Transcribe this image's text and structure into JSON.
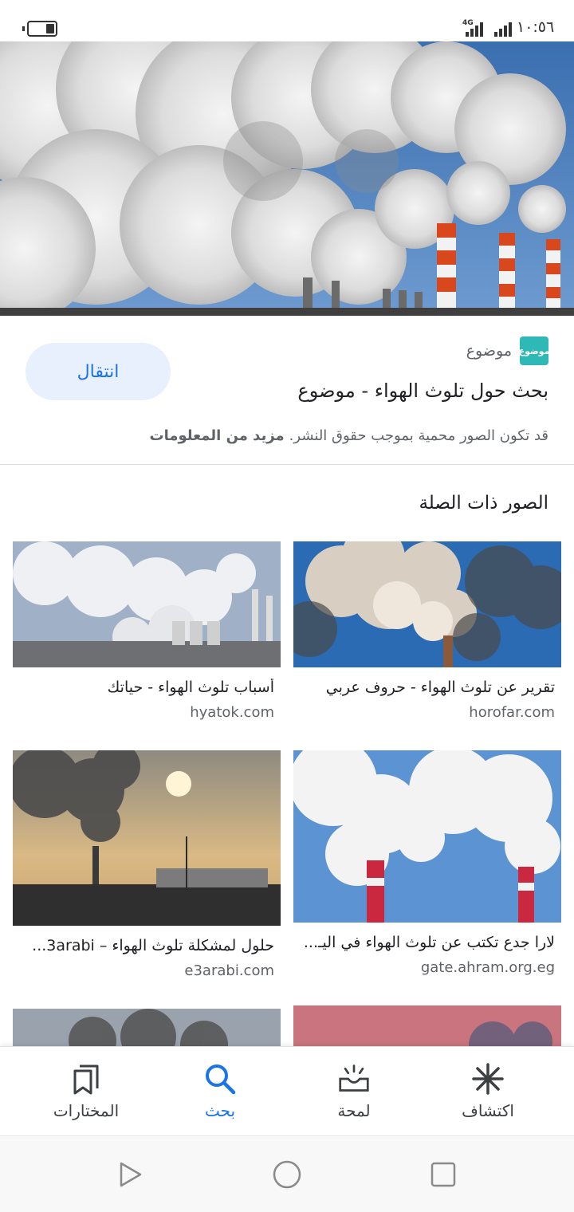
{
  "status_bar": {
    "time": "١٠:٥٦",
    "network": "4G"
  },
  "result": {
    "site_logo_text": "موضوع",
    "site_name": "موضوع",
    "title": "بحث حول تلوث الهواء - موضوع",
    "visit_label": "انتقال",
    "copyright_text": "قد تكون الصور محمية بموجب حقوق النشر.",
    "more_info_label": "مزيد من المعلومات"
  },
  "related": {
    "heading": "الصور ذات الصلة",
    "items": [
      {
        "title": "تقرير عن تلوث الهواء - حروف عربي",
        "domain": "horofar.com"
      },
      {
        "title": "أسباب تلوث الهواء - حياتك",
        "domain": "hyatok.com"
      },
      {
        "title": "لارا جدع تكتب عن تلوث الهواء في اليـ...",
        "domain": "gate.ahram.org.eg"
      },
      {
        "title": "حلول لمشكلة تلوث الهواء – 3arabi...",
        "domain": "e3arabi.com"
      }
    ]
  },
  "bottom_nav": {
    "items": [
      {
        "label": "اكتشاف",
        "icon": "asterisk-icon"
      },
      {
        "label": "لمحة",
        "icon": "inbox-sparkle-icon"
      },
      {
        "label": "بحث",
        "icon": "search-icon"
      },
      {
        "label": "المختارات",
        "icon": "bookmarks-icon"
      }
    ],
    "active": "بحث"
  },
  "colors": {
    "accent": "#1a73e8",
    "button_bg": "#e8f0fe",
    "logo_bg": "#2fb9b6"
  }
}
